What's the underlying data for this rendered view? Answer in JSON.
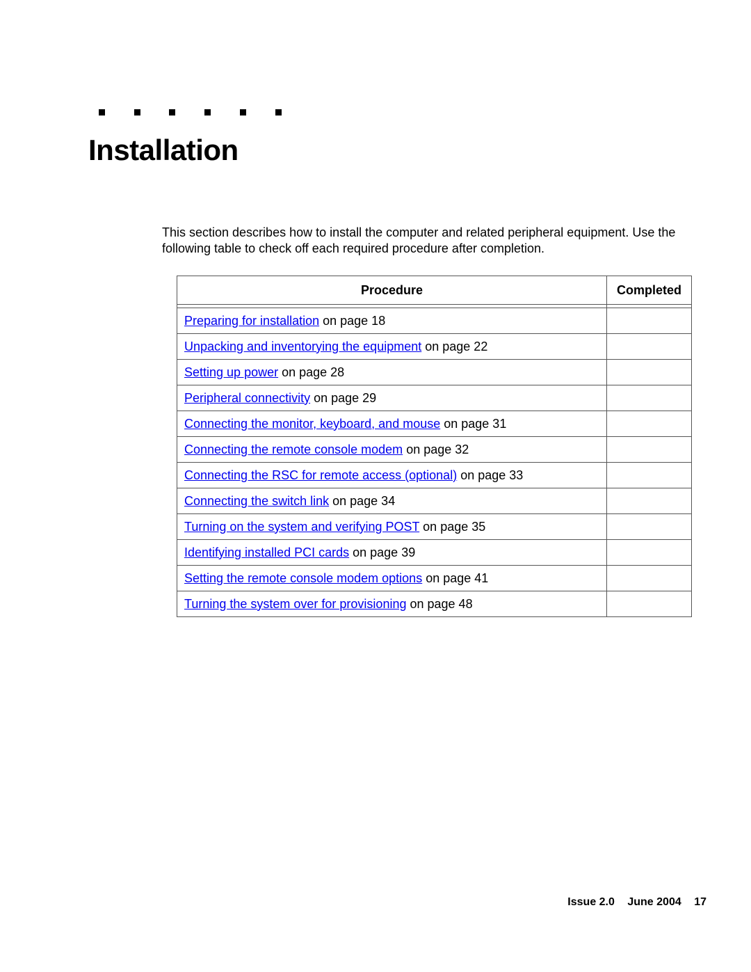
{
  "chapter": {
    "title": "Installation",
    "intro": "This section describes how to install the computer and related peripheral equipment. Use the following table to check off each required procedure after completion."
  },
  "table": {
    "headers": [
      "Procedure",
      "Completed"
    ],
    "rows": [
      {
        "link": "Preparing for installation",
        "suffix": " on page 18",
        "completed": ""
      },
      {
        "link": "Unpacking and inventorying the equipment",
        "suffix": " on page 22",
        "completed": ""
      },
      {
        "link": "Setting up power",
        "suffix": " on page 28",
        "completed": ""
      },
      {
        "link": "Peripheral connectivity",
        "suffix": " on page 29",
        "completed": ""
      },
      {
        "link": "Connecting the monitor, keyboard, and mouse",
        "suffix": " on page 31",
        "completed": ""
      },
      {
        "link": "Connecting the remote console modem",
        "suffix": " on page 32",
        "completed": ""
      },
      {
        "link": "Connecting the RSC for remote access (optional)",
        "suffix": " on page 33",
        "completed": ""
      },
      {
        "link": "Connecting the switch link",
        "suffix": " on page 34",
        "completed": ""
      },
      {
        "link": "Turning on the system and verifying POST",
        "suffix": " on page 35",
        "completed": ""
      },
      {
        "link": "Identifying installed PCI cards",
        "suffix": " on page 39",
        "completed": ""
      },
      {
        "link": "Setting the remote console modem options",
        "suffix": " on page 41",
        "completed": ""
      },
      {
        "link": "Turning the system over for provisioning",
        "suffix": " on page 48",
        "completed": ""
      }
    ]
  },
  "footer": {
    "issue": "Issue 2.0",
    "date": "June 2004",
    "page": "17"
  }
}
